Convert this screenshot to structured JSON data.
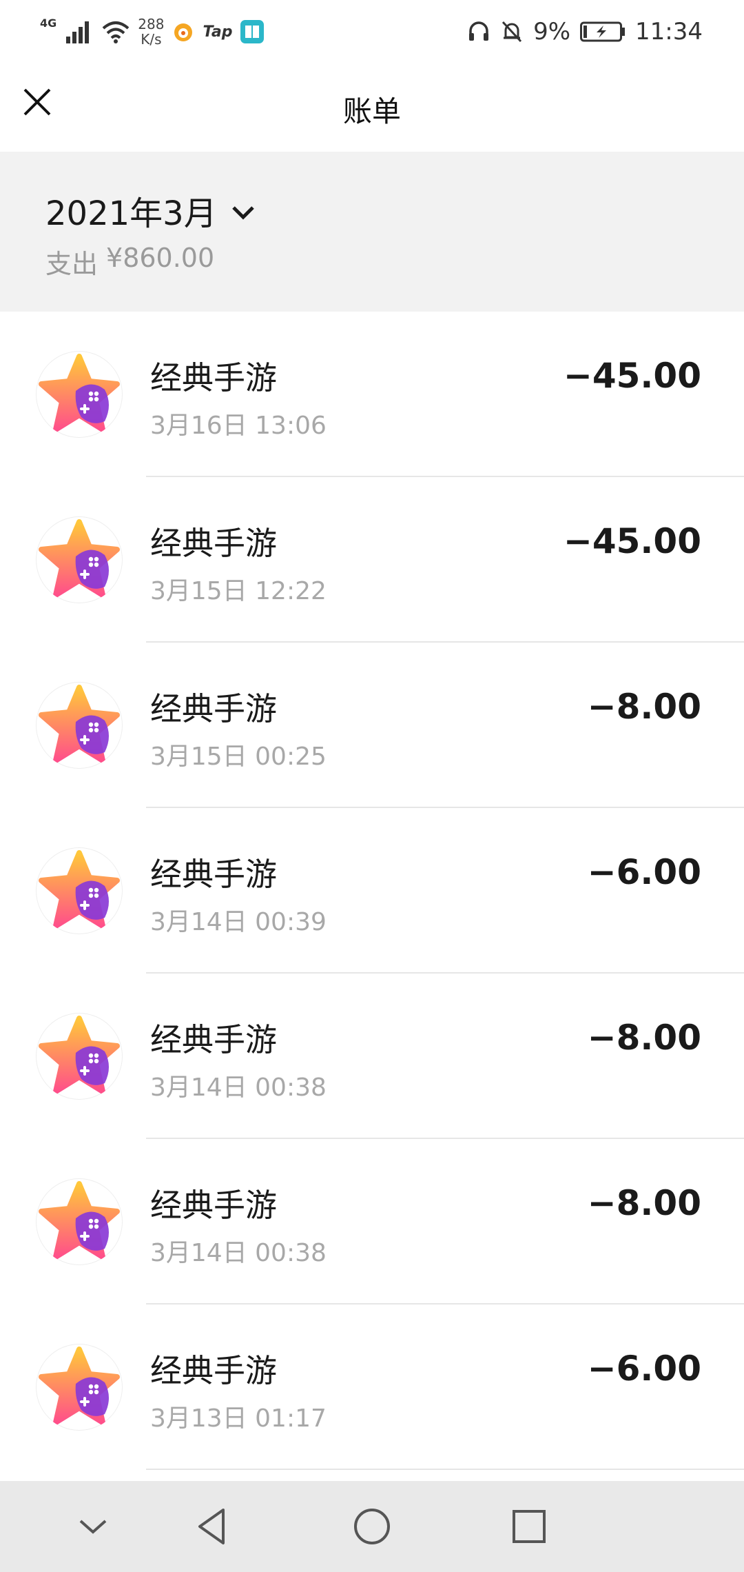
{
  "status_bar": {
    "network": "4G",
    "speed_value": "288",
    "speed_unit": "K/s",
    "tap_label": "Tap",
    "battery": "9%",
    "time": "11:34"
  },
  "header": {
    "title": "账单"
  },
  "summary": {
    "month": "2021年3月",
    "expense_label": "支出",
    "expense_amount": "¥860.00"
  },
  "transactions": [
    {
      "name": "经典手游",
      "time": "3月16日 13:06",
      "amount": "−45.00"
    },
    {
      "name": "经典手游",
      "time": "3月15日 12:22",
      "amount": "−45.00"
    },
    {
      "name": "经典手游",
      "time": "3月15日 00:25",
      "amount": "−8.00"
    },
    {
      "name": "经典手游",
      "time": "3月14日 00:39",
      "amount": "−6.00"
    },
    {
      "name": "经典手游",
      "time": "3月14日 00:38",
      "amount": "−8.00"
    },
    {
      "name": "经典手游",
      "time": "3月14日 00:38",
      "amount": "−8.00"
    },
    {
      "name": "经典手游",
      "time": "3月13日 01:17",
      "amount": "−6.00"
    }
  ],
  "colors": {
    "summary_bg": "#f2f2f2",
    "navbar_bg": "#e9e9e9",
    "star_gradient_top": "#ffc83a",
    "star_gradient_bottom": "#ff4f8a",
    "gamepad_purple": "#8a3ad6"
  },
  "icons": {
    "close": "close-icon",
    "month_dropdown": "chevron-down-icon",
    "app": "star-gamepad-icon",
    "nav": [
      "chevron-down-icon",
      "back-triangle-icon",
      "home-circle-icon",
      "recents-square-icon"
    ]
  }
}
